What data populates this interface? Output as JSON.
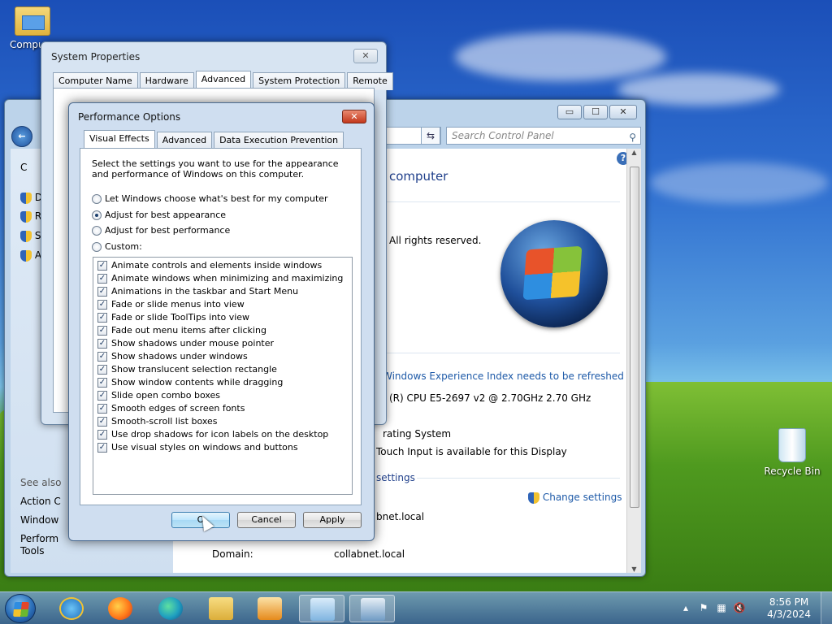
{
  "desktop": {
    "icons": [
      {
        "label": "Computer",
        "visible_label": "Compu"
      },
      {
        "label": "Recycle Bin"
      }
    ]
  },
  "control_panel": {
    "search_placeholder": "Search Control Panel",
    "heading": "computer",
    "rights": "All rights reserved.",
    "wei_link": "Windows Experience Index needs to be refreshed",
    "cpu": "(R) CPU E5-2697 v2 @ 2.70GHz   2.70 GHz",
    "os_type": "rating System",
    "touch": "Touch Input is available for this Display",
    "settings_header": "settings",
    "change_settings": "Change settings",
    "domain_value_partial": "bnet.local",
    "domain_label": "Domain:",
    "domain_value": "collabnet.local",
    "left_items": [
      "C",
      "D",
      "Re",
      "Sy",
      "A"
    ],
    "see_also": "See also",
    "see_also_items": [
      "Action C",
      "Window",
      "Perform\nTools"
    ]
  },
  "system_properties": {
    "title": "System Properties",
    "tabs": [
      "Computer Name",
      "Hardware",
      "Advanced",
      "System Protection",
      "Remote"
    ],
    "active_tab": "Advanced"
  },
  "performance_options": {
    "title": "Performance Options",
    "tabs": [
      "Visual Effects",
      "Advanced",
      "Data Execution Prevention"
    ],
    "active_tab": "Visual Effects",
    "description": "Select the settings you want to use for the appearance and performance of Windows on this computer.",
    "radios": [
      {
        "label": "Let Windows choose what's best for my computer",
        "checked": false
      },
      {
        "label": "Adjust for best appearance",
        "checked": true
      },
      {
        "label": "Adjust for best performance",
        "checked": false
      },
      {
        "label": "Custom:",
        "checked": false
      }
    ],
    "effects": [
      {
        "label": "Animate controls and elements inside windows",
        "checked": true
      },
      {
        "label": "Animate windows when minimizing and maximizing",
        "checked": true
      },
      {
        "label": "Animations in the taskbar and Start Menu",
        "checked": true
      },
      {
        "label": "Fade or slide menus into view",
        "checked": true
      },
      {
        "label": "Fade or slide ToolTips into view",
        "checked": true
      },
      {
        "label": "Fade out menu items after clicking",
        "checked": true
      },
      {
        "label": "Show shadows under mouse pointer",
        "checked": true
      },
      {
        "label": "Show shadows under windows",
        "checked": true
      },
      {
        "label": "Show translucent selection rectangle",
        "checked": true
      },
      {
        "label": "Show window contents while dragging",
        "checked": true
      },
      {
        "label": "Slide open combo boxes",
        "checked": true
      },
      {
        "label": "Smooth edges of screen fonts",
        "checked": true
      },
      {
        "label": "Smooth-scroll list boxes",
        "checked": true
      },
      {
        "label": "Use drop shadows for icon labels on the desktop",
        "checked": true
      },
      {
        "label": "Use visual styles on windows and buttons",
        "checked": true
      }
    ],
    "buttons": {
      "ok": "OK",
      "ok_visible": "O",
      "cancel": "Cancel",
      "apply": "Apply"
    }
  },
  "taskbar": {
    "apps": [
      "internet-explorer",
      "firefox",
      "edge",
      "file-explorer",
      "media-player",
      "control-panel",
      "system-properties"
    ],
    "time": "8:56 PM",
    "date": "4/3/2024"
  }
}
